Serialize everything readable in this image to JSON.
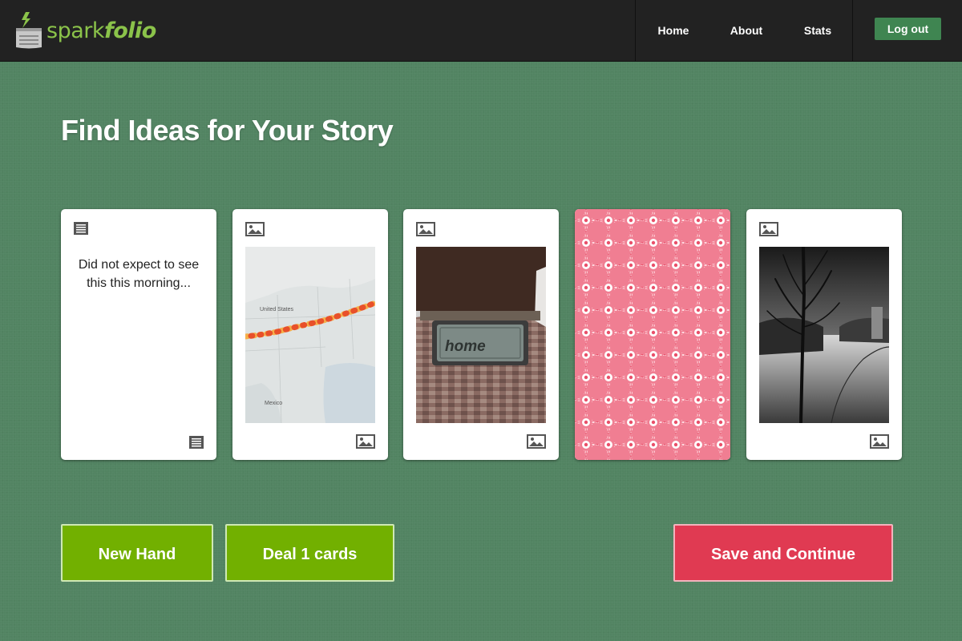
{
  "brand": {
    "name_part1": "spark",
    "name_part2": "folio"
  },
  "nav": {
    "items": [
      {
        "label": "Home"
      },
      {
        "label": "About"
      },
      {
        "label": "Stats"
      }
    ],
    "logout_label": "Log out"
  },
  "page": {
    "title": "Find Ideas for Your Story"
  },
  "cards": [
    {
      "kind": "text",
      "icon": "text-lines-icon",
      "text": "Did not expect to see this this morning..."
    },
    {
      "kind": "image",
      "icon": "image-icon",
      "subject": "map",
      "map_labels": {
        "country": "United States",
        "neighbor": "Mexico"
      }
    },
    {
      "kind": "image",
      "icon": "image-icon",
      "subject": "doormat",
      "mat_text": "home"
    },
    {
      "kind": "back",
      "icon": "none",
      "subject": "card-back-pattern"
    },
    {
      "kind": "image",
      "icon": "image-icon",
      "subject": "snowy-tree"
    }
  ],
  "actions": {
    "new_hand_label": "New Hand",
    "deal_label": "Deal 1 cards",
    "save_label": "Save and Continue"
  },
  "colors": {
    "background": "#528462",
    "header": "#222222",
    "brand_green": "#8bc34a",
    "button_green": "#72b000",
    "button_red": "#e03a52",
    "logout_green": "#3f8551"
  }
}
